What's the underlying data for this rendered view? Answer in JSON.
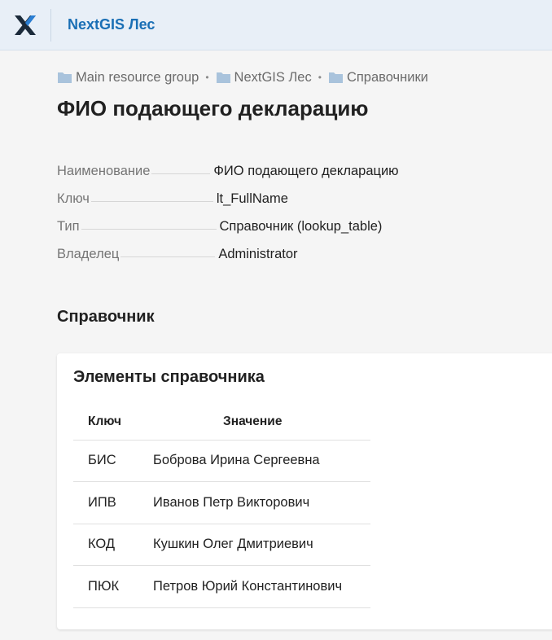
{
  "header": {
    "app_title": "NextGIS Лес",
    "logo_icon": "nextgis-x-logo",
    "colors": {
      "background": "#e8eff7",
      "title": "#1a6fb5",
      "logo_dark": "#1b2a3a",
      "logo_blue": "#2b7fd4"
    }
  },
  "breadcrumbs": [
    {
      "label": "Main resource group",
      "icon": "folder-icon"
    },
    {
      "label": "NextGIS Лес",
      "icon": "folder-icon"
    },
    {
      "label": "Справочники",
      "icon": "folder-icon"
    }
  ],
  "breadcrumb_separator": "•",
  "page_title": "ФИО подающего декларацию",
  "properties": [
    {
      "key": "Наименование",
      "value": "ФИО подающего декларацию"
    },
    {
      "key": "Ключ",
      "value": "lt_FullName"
    },
    {
      "key": "Тип",
      "value": "Справочник (lookup_table)"
    },
    {
      "key": "Владелец",
      "value": "Administrator"
    }
  ],
  "section_title": "Справочник",
  "lookup_card": {
    "title": "Элементы справочника",
    "columns": [
      "Ключ",
      "Значение"
    ],
    "rows": [
      {
        "key": "БИС",
        "value": "Боброва Ирина Сергеевна"
      },
      {
        "key": "ИПВ",
        "value": "Иванов Петр Викторович"
      },
      {
        "key": "КОД",
        "value": "Кушкин Олег Дмитриевич"
      },
      {
        "key": "ПЮК",
        "value": "Петров Юрий Константинович"
      }
    ]
  }
}
